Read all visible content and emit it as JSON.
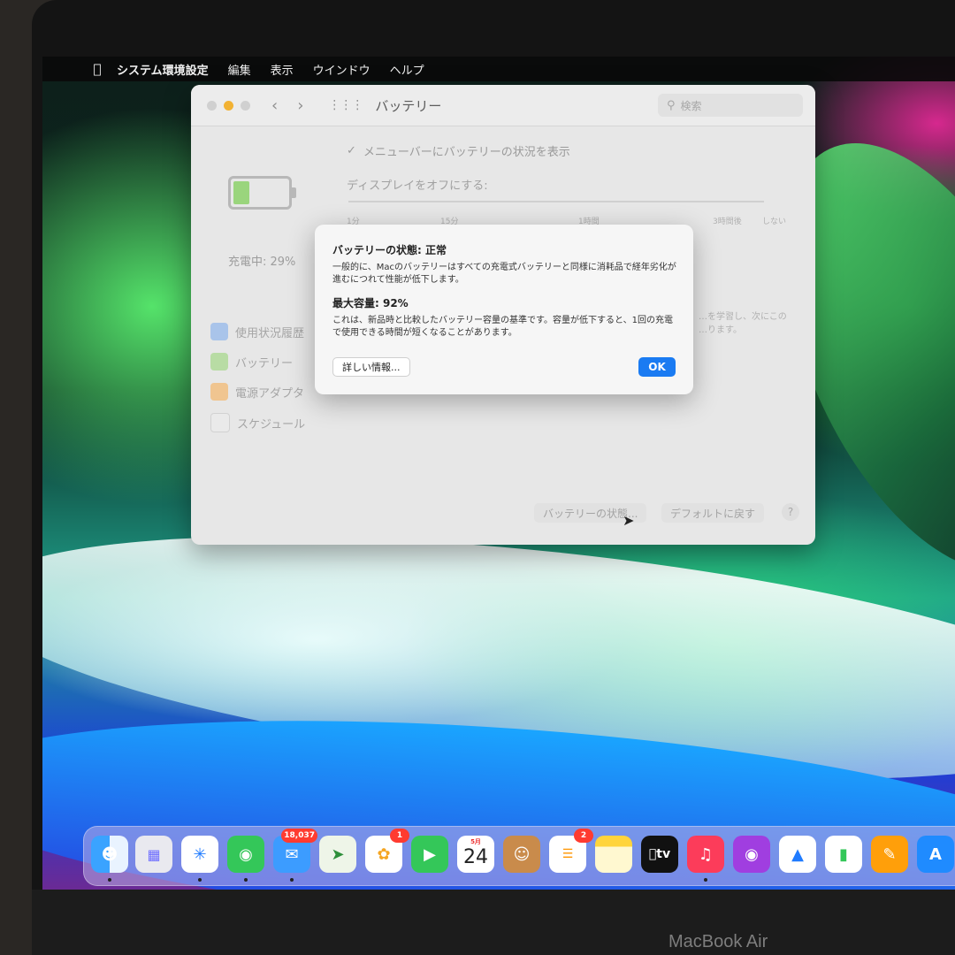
{
  "menubar": {
    "apple": "",
    "items": [
      "システム環境設定",
      "編集",
      "表示",
      "ウインドウ",
      "ヘルプ"
    ]
  },
  "prefs": {
    "title": "バッテリー",
    "search_placeholder": "検索",
    "show_menu_status": "メニューバーにバッテリーの状況を表示",
    "display_off": "ディスプレイをオフにする:",
    "slider_labels": [
      "1分",
      "15分",
      "1時間",
      "3時間後",
      "しない"
    ],
    "charge": "充電中: 29%",
    "sidebar": [
      "使用状況履歴",
      "バッテリー",
      "電源アダプタ",
      "スケジュール"
    ],
    "learn_text": [
      "…を学習し、次にこの",
      "…ります。"
    ],
    "battery_health_button": "バッテリーの状態...",
    "default_button": "デフォルトに戻す",
    "help": "?"
  },
  "dialog": {
    "title": "バッテリーの状態: 正常",
    "body1": "一般的に、Macのバッテリーはすべての充電式バッテリーと同様に消耗品で経年劣化が進むにつれて性能が低下します。",
    "capacity": "最大容量: 92%",
    "body2": "これは、新品時と比較したバッテリー容量の基準です。容量が低下すると、1回の充電で使用できる時間が短くなることがあります。",
    "more_button": "詳しい情報...",
    "ok_button": "OK"
  },
  "dock": {
    "mail_badge": "18,037",
    "photos_badge": "1",
    "reminders_badge": "2",
    "calendar_month": "5月",
    "calendar_day": "24",
    "tv_label": "tv"
  },
  "brand": "MacBook Air"
}
